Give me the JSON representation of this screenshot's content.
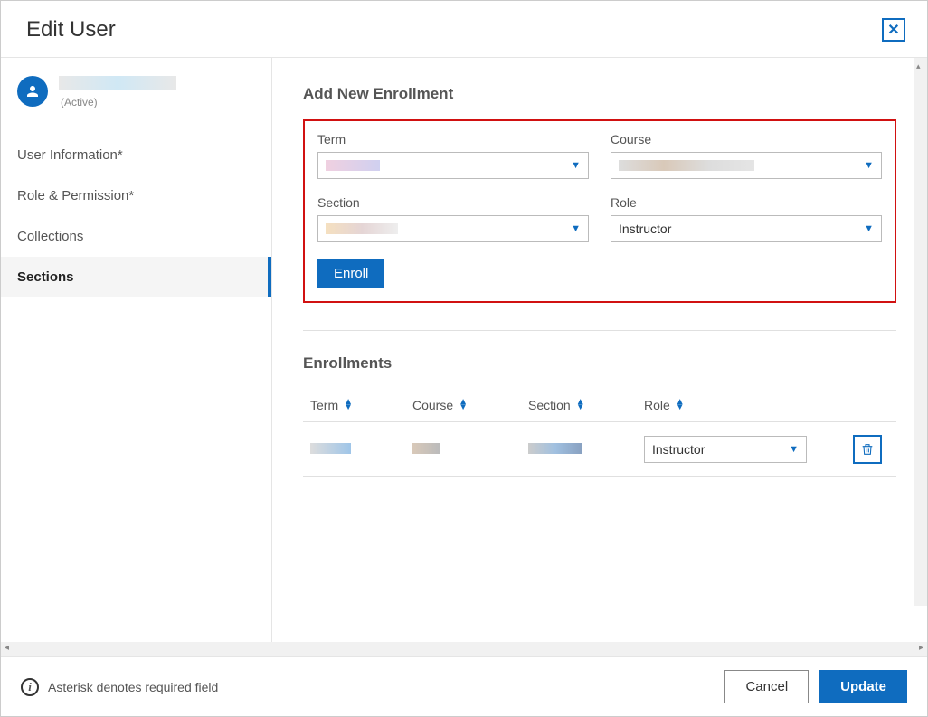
{
  "header": {
    "title": "Edit User"
  },
  "user": {
    "status": "(Active)"
  },
  "nav": {
    "items": [
      {
        "label": "User Information*"
      },
      {
        "label": "Role & Permission*"
      },
      {
        "label": "Collections"
      },
      {
        "label": "Sections"
      }
    ],
    "activeIndex": 3
  },
  "addEnrollment": {
    "title": "Add New Enrollment",
    "labels": {
      "term": "Term",
      "course": "Course",
      "section": "Section",
      "role": "Role"
    },
    "role_value": "Instructor",
    "enroll_label": "Enroll"
  },
  "enrollments": {
    "title": "Enrollments",
    "columns": {
      "term": "Term",
      "course": "Course",
      "section": "Section",
      "role": "Role"
    },
    "rows": [
      {
        "role": "Instructor"
      }
    ]
  },
  "footer": {
    "hint": "Asterisk denotes required field",
    "cancel": "Cancel",
    "update": "Update"
  }
}
